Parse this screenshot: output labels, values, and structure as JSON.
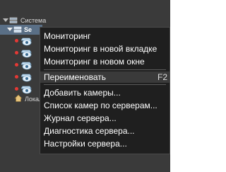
{
  "tree": {
    "root_label": "Система",
    "server_label": "Se",
    "local_label": "Локал"
  },
  "menu": {
    "items": [
      {
        "label": "Мониторинг",
        "shortcut": ""
      },
      {
        "label": "Мониторинг в новой вкладке",
        "shortcut": ""
      },
      {
        "label": "Мониторинг в новом окне",
        "shortcut": ""
      },
      {
        "label": "Переименовать",
        "shortcut": "F2"
      },
      {
        "label": "Добавить камеры...",
        "shortcut": ""
      },
      {
        "label": "Список камер по серверам...",
        "shortcut": ""
      },
      {
        "label": "Журнал сервера...",
        "shortcut": ""
      },
      {
        "label": "Диагностика сервера...",
        "shortcut": ""
      },
      {
        "label": "Настройки сервера...",
        "shortcut": ""
      }
    ],
    "highlighted_index": 3
  },
  "colors": {
    "menu_bg": "#1f1f1f",
    "tree_bg": "#3a3a3a",
    "highlight_bg": "#3a3a3a",
    "status_dot": "#e53935"
  }
}
